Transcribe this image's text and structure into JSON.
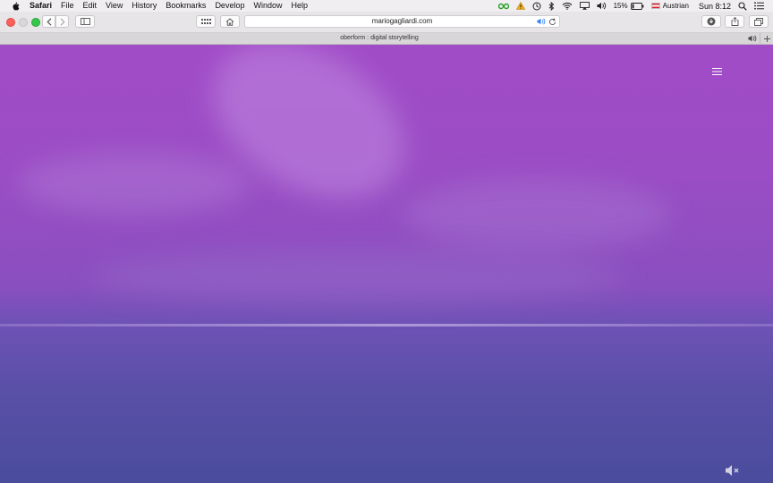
{
  "menubar": {
    "app_name": "Safari",
    "menus": [
      "File",
      "Edit",
      "View",
      "History",
      "Bookmarks",
      "Develop",
      "Window",
      "Help"
    ],
    "status": {
      "battery_percent": "15%",
      "input_source": "Austrian",
      "clock": "Sun 8:12"
    }
  },
  "toolbar": {
    "url": "mariogagliardi.com"
  },
  "tab": {
    "title": "oberform : digital storytelling"
  },
  "page": {
    "menu_icon": "hamburger-menu-icon",
    "mute_icon": "speaker-muted-icon"
  },
  "colors": {
    "sky_top": "#a14cc7",
    "sea_bottom": "#4a4c9c"
  }
}
